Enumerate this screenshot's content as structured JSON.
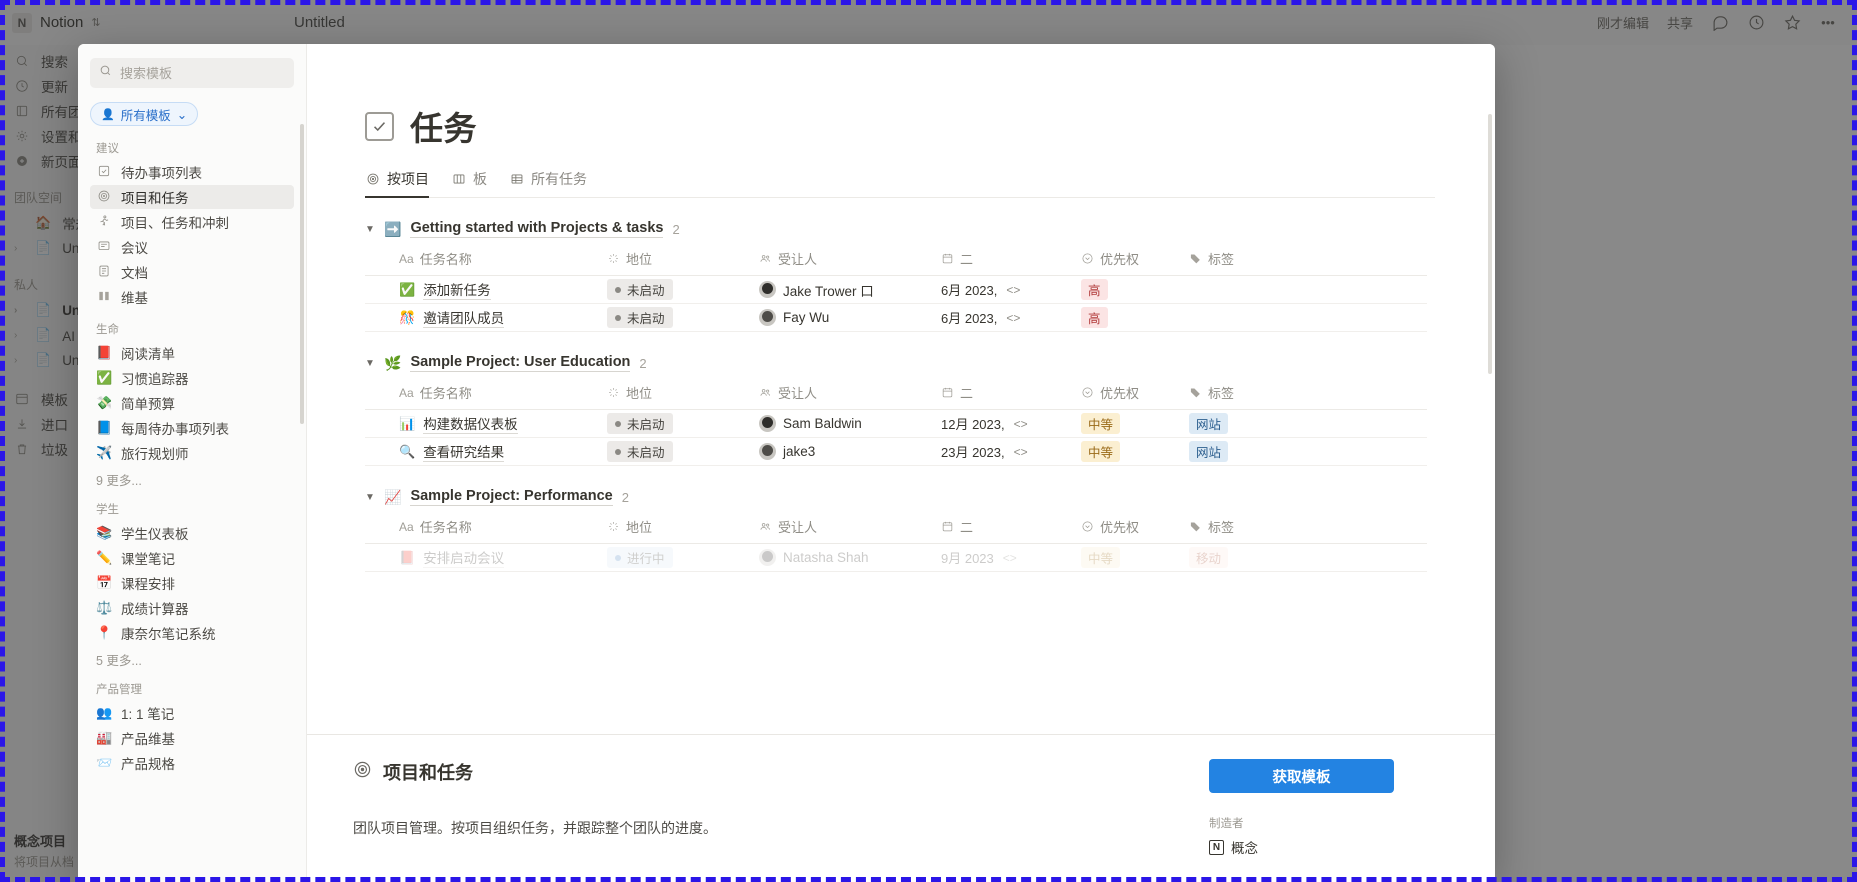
{
  "topbar": {
    "logo_letter": "N",
    "workspace": "Notion",
    "page_title": "Untitled",
    "edited_label": "刚才编辑",
    "share_label": "共享",
    "icons": [
      "comment-icon",
      "clock-icon",
      "star-icon",
      "more-icon"
    ]
  },
  "sidebar": {
    "nav": [
      {
        "icon": "search-icon",
        "label": "搜索"
      },
      {
        "icon": "clock-icon",
        "label": "更新"
      },
      {
        "icon": "building-icon",
        "label": "所有团队"
      },
      {
        "icon": "gear-icon",
        "label": "设置和成"
      },
      {
        "icon": "plus-circle-icon",
        "label": "新页面"
      }
    ],
    "team_section": "团队空间",
    "team_items": [
      {
        "emoji": "🏠",
        "label": "常规",
        "caret": false
      },
      {
        "emoji": "📄",
        "label": "Untitled",
        "caret": true
      }
    ],
    "private_section": "私人",
    "private_items": [
      {
        "emoji": "📄",
        "label": "Untitled",
        "caret": true,
        "bold": true
      },
      {
        "emoji": "📄",
        "label": "AI 绘画",
        "caret": true,
        "bold": false
      },
      {
        "emoji": "📄",
        "label": "Untitled",
        "caret": true,
        "bold": false
      }
    ],
    "footer_items": [
      {
        "icon": "template-icon",
        "label": "模板"
      },
      {
        "icon": "import-icon",
        "label": "进口"
      },
      {
        "icon": "trash-icon",
        "label": "垃圾"
      }
    ],
    "bottom_title": "概念项目",
    "bottom_sub": "将项目从档"
  },
  "modal": {
    "search": {
      "placeholder": "搜索模板",
      "value": "",
      "icon": "search-icon"
    },
    "filter": {
      "label": "所有模板",
      "icon": "person-icon",
      "chevron": "chevron-down-icon"
    },
    "sections": [
      {
        "title": "建议",
        "items": [
          {
            "icon": "checkbox-icon",
            "label": "待办事项列表",
            "active": false
          },
          {
            "icon": "target-icon",
            "label": "项目和任务",
            "active": true
          },
          {
            "icon": "runner-icon",
            "label": "项目、任务和冲刺",
            "active": false
          },
          {
            "icon": "meeting-icon",
            "label": "会议",
            "active": false
          },
          {
            "icon": "doc-icon",
            "label": "文档",
            "active": false
          },
          {
            "icon": "book-icon",
            "label": "维基",
            "active": false
          }
        ],
        "more": ""
      },
      {
        "title": "生命",
        "items": [
          {
            "icon": "📕",
            "label": "阅读清单",
            "active": false
          },
          {
            "icon": "✅",
            "label": "习惯追踪器",
            "active": false
          },
          {
            "icon": "💸",
            "label": "简单预算",
            "active": false
          },
          {
            "icon": "📘",
            "label": "每周待办事项列表",
            "active": false
          },
          {
            "icon": "✈️",
            "label": "旅行规划师",
            "active": false
          }
        ],
        "more": "9 更多..."
      },
      {
        "title": "学生",
        "items": [
          {
            "icon": "📚",
            "label": "学生仪表板",
            "active": false
          },
          {
            "icon": "✏️",
            "label": "课堂笔记",
            "active": false
          },
          {
            "icon": "📅",
            "label": "课程安排",
            "active": false
          },
          {
            "icon": "⚖️",
            "label": "成绩计算器",
            "active": false
          },
          {
            "icon": "📍",
            "label": "康奈尔笔记系统",
            "active": false
          }
        ],
        "more": "5 更多..."
      },
      {
        "title": "产品管理",
        "items": [
          {
            "icon": "👥",
            "label": "1: 1 笔记",
            "active": false
          },
          {
            "icon": "🏭",
            "label": "产品维基",
            "active": false
          },
          {
            "icon": "📨",
            "label": "产品规格",
            "active": false
          }
        ],
        "more": ""
      }
    ]
  },
  "preview": {
    "page_title": "任务",
    "title_icon": "checkbox-icon",
    "tabs": [
      {
        "icon": "target-icon",
        "label": "按项目",
        "active": true
      },
      {
        "icon": "board-icon",
        "label": "板",
        "active": false
      },
      {
        "icon": "table-icon",
        "label": "所有任务",
        "active": false
      }
    ],
    "columns": [
      {
        "icon": "aa-icon",
        "label": "任务名称"
      },
      {
        "icon": "spinner-icon",
        "label": "地位"
      },
      {
        "icon": "people-icon",
        "label": "受让人"
      },
      {
        "icon": "calendar-icon",
        "label": "二"
      },
      {
        "icon": "priority-icon",
        "label": "优先权"
      },
      {
        "icon": "tag-icon",
        "label": "标签"
      }
    ],
    "groups": [
      {
        "emoji": "➡️",
        "name": "Getting started with Projects & tasks",
        "count": "2",
        "rows": [
          {
            "emoji": "✅",
            "name": "添加新任务",
            "status": "未启动",
            "status_style": "gray",
            "assignee": "Jake Trower 口",
            "date": "6月 2023,",
            "priority": "高",
            "priority_style": "high",
            "tag": "",
            "tag_style": ""
          },
          {
            "emoji": "🎊",
            "name": "邀请团队成员",
            "status": "未启动",
            "status_style": "gray",
            "assignee": "Fay Wu",
            "date": "6月 2023,",
            "priority": "高",
            "priority_style": "high",
            "tag": "",
            "tag_style": ""
          }
        ]
      },
      {
        "emoji": "🌿",
        "name": "Sample Project: User Education",
        "count": "2",
        "rows": [
          {
            "emoji": "📊",
            "name": "构建数据仪表板",
            "status": "未启动",
            "status_style": "gray",
            "assignee": "Sam Baldwin",
            "date": "12月 2023,",
            "priority": "中等",
            "priority_style": "mid",
            "tag": "网站",
            "tag_style": "web"
          },
          {
            "emoji": "🔍",
            "name": "查看研究结果",
            "status": "未启动",
            "status_style": "gray",
            "assignee": "jake3",
            "date": "23月 2023,",
            "priority": "中等",
            "priority_style": "mid",
            "tag": "网站",
            "tag_style": "web"
          }
        ]
      },
      {
        "emoji": "📈",
        "name": "Sample Project: Performance",
        "count": "2",
        "rows": [
          {
            "emoji": "📕",
            "name": "安排启动会议",
            "status": "进行中",
            "status_style": "blue",
            "assignee": "Natasha Shah",
            "date": "9月 2023",
            "priority": "中等",
            "priority_style": "mid",
            "tag": "移动",
            "tag_style": "act"
          }
        ]
      }
    ],
    "date_arrows": "<>"
  },
  "template_card": {
    "icon": "target-icon",
    "title": "项目和任务",
    "description": "团队项目管理。按项目组织任务，并跟踪整个团队的进度。",
    "cta_label": "获取模板",
    "by_label": "制造者",
    "author": "概念",
    "author_logo": "N",
    "accent_color": "#2383e2"
  }
}
